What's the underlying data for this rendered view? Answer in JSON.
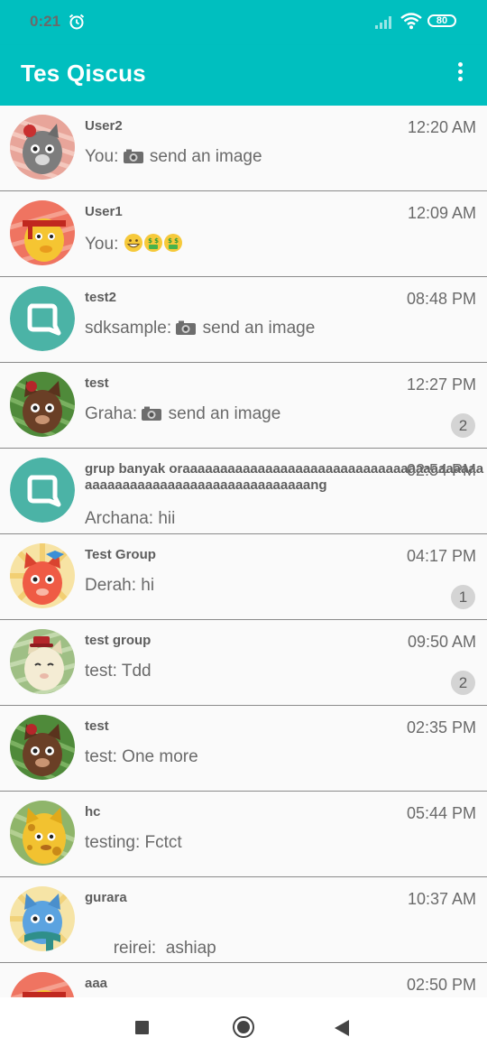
{
  "status_bar": {
    "time": "0:21",
    "battery": "80",
    "icons": [
      "alarm-icon",
      "signal-icon",
      "wifi-icon",
      "battery-icon"
    ]
  },
  "app_bar": {
    "title": "Tes Qiscus",
    "menu_icon": "more-vert-icon"
  },
  "colors": {
    "primary": "#00bfbf",
    "badge_bg": "#d4d4d4",
    "qiscus_avatar": "#4bb3a6"
  },
  "conversations": [
    {
      "name": "User2",
      "time": "12:20 AM",
      "prefix": "You: ",
      "message": "send an image",
      "preview_icon": "camera-icon",
      "avatar": "gray-cat-avatar"
    },
    {
      "name": "User1",
      "time": "12:09 AM",
      "prefix": "You: ",
      "message": "",
      "preview_emojis": [
        "grinning-emoji",
        "money-face-emoji",
        "money-face-emoji"
      ],
      "avatar": "yellow-cat-headband-avatar"
    },
    {
      "name": "test2",
      "time": "08:48 PM",
      "prefix": "sdksample: ",
      "message": "send an image",
      "preview_icon": "camera-icon",
      "avatar": "qiscus-logo-avatar"
    },
    {
      "name": "test",
      "time": "12:27 PM",
      "prefix": "Graha: ",
      "message": "send an image",
      "preview_icon": "camera-icon",
      "badge": "2",
      "avatar": "brown-cat-avatar"
    },
    {
      "name": "grup banyak oraaaaaaaaaaaaaaaaaaaaaaaaaaaaaaaaaaaaaaaaaaaaaaaaaaaaaaaaaaaaaaaaaaaaaang",
      "time": "02:54 PM",
      "prefix": "",
      "message": "Archana: hii",
      "avatar": "qiscus-logo-avatar"
    },
    {
      "name": "Test Group",
      "time": "04:17 PM",
      "prefix": "",
      "message": "Derah: hi",
      "badge": "1",
      "avatar": "red-cat-bow-avatar"
    },
    {
      "name": "test group",
      "time": "09:50 AM",
      "prefix": "",
      "message": "test: Tdd",
      "badge": "2",
      "avatar": "cream-cat-hat-avatar"
    },
    {
      "name": "test",
      "time": "02:35 PM",
      "prefix": "",
      "message": "test: One more",
      "avatar": "brown-cat-avatar"
    },
    {
      "name": "hc",
      "time": "05:44 PM",
      "prefix": "",
      "message": "testing: Fctct",
      "avatar": "giraffe-cat-avatar"
    },
    {
      "name": "gurara",
      "time": "10:37 AM",
      "prefix": "",
      "message": "reirei:  ashiap",
      "avatar": "blue-cat-scarf-avatar"
    },
    {
      "name": "aaa",
      "time": "02:50 PM",
      "prefix": "",
      "message": "",
      "avatar": "yellow-cat-headband-avatar"
    }
  ],
  "nav_bar": {
    "icons": [
      "recents-square-icon",
      "home-circle-icon",
      "back-triangle-icon"
    ]
  }
}
